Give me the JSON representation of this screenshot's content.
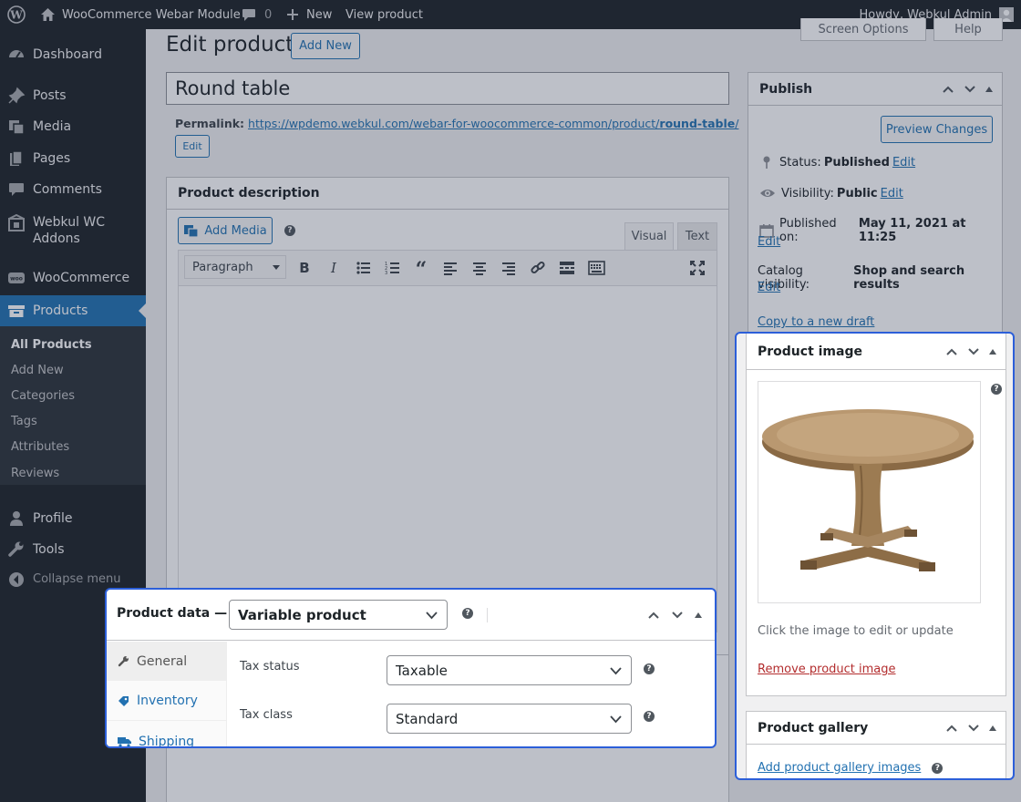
{
  "adminbar": {
    "site_name": "WooCommerce Webar Module",
    "comments_count": "0",
    "new_label": "New",
    "view_label": "View product",
    "howdy": "Howdy, Webkul Admin"
  },
  "sidebar": {
    "items": [
      {
        "label": "Dashboard",
        "icon": "dashboard-icon"
      },
      {
        "label": "Posts",
        "icon": "pin-icon"
      },
      {
        "label": "Media",
        "icon": "media-icon"
      },
      {
        "label": "Pages",
        "icon": "pages-icon"
      },
      {
        "label": "Comments",
        "icon": "comments-icon"
      },
      {
        "label": "Webkul WC Addons",
        "icon": "addons-icon"
      },
      {
        "label": "WooCommerce",
        "icon": "woo-icon"
      },
      {
        "label": "Products",
        "icon": "archive-icon"
      },
      {
        "label": "Profile",
        "icon": "user-icon"
      },
      {
        "label": "Tools",
        "icon": "wrench-icon"
      },
      {
        "label": "Collapse menu",
        "icon": "collapse-icon"
      }
    ],
    "submenu": [
      "All Products",
      "Add New",
      "Categories",
      "Tags",
      "Attributes",
      "Reviews"
    ]
  },
  "header": {
    "title": "Edit product",
    "add_new": "Add New",
    "screen_options": "Screen Options",
    "help": "Help"
  },
  "product": {
    "name": "Round table",
    "permalink_label": "Permalink:",
    "permalink_base": "https://wpdemo.webkul.com/webar-for-woocommerce-common/product/",
    "permalink_slug": "round-table",
    "permalink_end": "/",
    "edit_label": "Edit"
  },
  "editor": {
    "title": "Product description",
    "add_media": "Add Media",
    "tab_visual": "Visual",
    "tab_text": "Text",
    "format_select": "Paragraph"
  },
  "publish": {
    "title": "Publish",
    "preview": "Preview Changes",
    "status_label": "Status:",
    "status_value": "Published",
    "visibility_label": "Visibility:",
    "visibility_value": "Public",
    "published_label": "Published on:",
    "published_value": "May 11, 2021 at 11:25",
    "catalog_label": "Catalog visibility:",
    "catalog_value": "Shop and search results",
    "edit": "Edit",
    "copy_draft": "Copy to a new draft"
  },
  "product_image": {
    "title": "Product image",
    "hint": "Click the image to edit or update",
    "remove": "Remove product image"
  },
  "product_gallery": {
    "title": "Product gallery",
    "add": "Add product gallery images"
  },
  "product_data": {
    "title": "Product data —",
    "type": "Variable product",
    "tabs": [
      "General",
      "Inventory",
      "Shipping"
    ],
    "tax_status_label": "Tax status",
    "tax_status_value": "Taxable",
    "tax_class_label": "Tax class",
    "tax_class_value": "Standard"
  },
  "colors": {
    "admin_dark": "#1d2327",
    "accent": "#2271b1",
    "highlight": "#2c5fd9",
    "remove": "#b32d2e"
  }
}
